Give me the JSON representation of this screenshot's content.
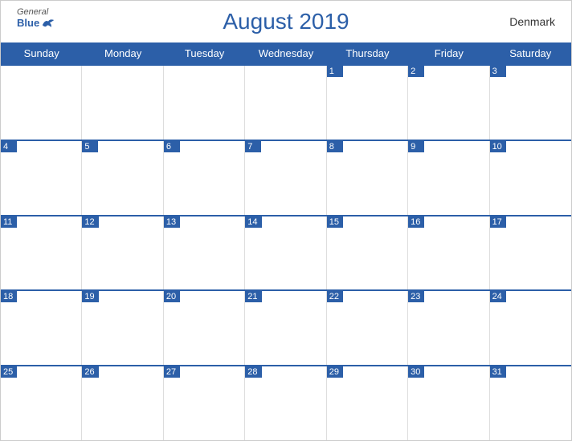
{
  "header": {
    "title": "August 2019",
    "country": "Denmark",
    "logo": {
      "general": "General",
      "blue": "Blue"
    }
  },
  "dayHeaders": [
    "Sunday",
    "Monday",
    "Tuesday",
    "Wednesday",
    "Thursday",
    "Friday",
    "Saturday"
  ],
  "weeks": [
    [
      null,
      null,
      null,
      null,
      1,
      2,
      3
    ],
    [
      4,
      5,
      6,
      7,
      8,
      9,
      10
    ],
    [
      11,
      12,
      13,
      14,
      15,
      16,
      17
    ],
    [
      18,
      19,
      20,
      21,
      22,
      23,
      24
    ],
    [
      25,
      26,
      27,
      28,
      29,
      30,
      31
    ]
  ],
  "colors": {
    "blue": "#2c5fa8",
    "headerText": "#fff",
    "border": "#ccc"
  }
}
